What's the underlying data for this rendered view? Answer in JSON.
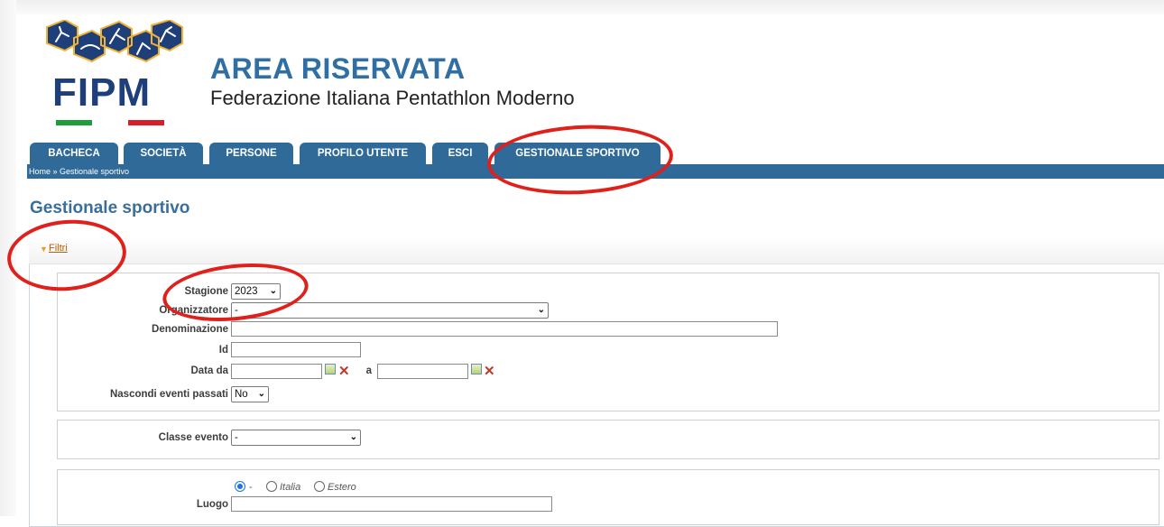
{
  "header": {
    "logo_text": "FIPM",
    "title": "AREA RISERVATA",
    "subtitle": "Federazione Italiana Pentathlon Moderno"
  },
  "tabs": [
    {
      "label": "BACHECA"
    },
    {
      "label": "SOCIETÀ"
    },
    {
      "label": "PERSONE"
    },
    {
      "label": "PROFILO UTENTE"
    },
    {
      "label": "ESCI"
    },
    {
      "label": "GESTIONALE SPORTIVO"
    }
  ],
  "breadcrumb": "Home » Gestionale sportivo",
  "page_title": "Gestionale sportivo",
  "filters": {
    "toggle_label": "Filtri",
    "stagione_label": "Stagione",
    "stagione_value": "2023",
    "organizzatore_label": "Organizzatore",
    "organizzatore_value": "-",
    "denominazione_label": "Denominazione",
    "denominazione_value": "",
    "id_label": "Id",
    "id_value": "",
    "data_da_label": "Data da",
    "data_a_label": "a",
    "data_da_value": "",
    "data_a_value": "",
    "nascondi_label": "Nascondi eventi passati",
    "nascondi_value": "No",
    "classe_label": "Classe evento",
    "classe_value": "-",
    "luogo_options": [
      "-",
      "Italia",
      "Estero"
    ],
    "luogo_selected": "-",
    "luogo_label": "Luogo",
    "luogo_value": ""
  },
  "colors": {
    "tab_blue": "#2f6a99",
    "title_blue": "#2f6fa3",
    "annotation_red": "#e0201b"
  }
}
